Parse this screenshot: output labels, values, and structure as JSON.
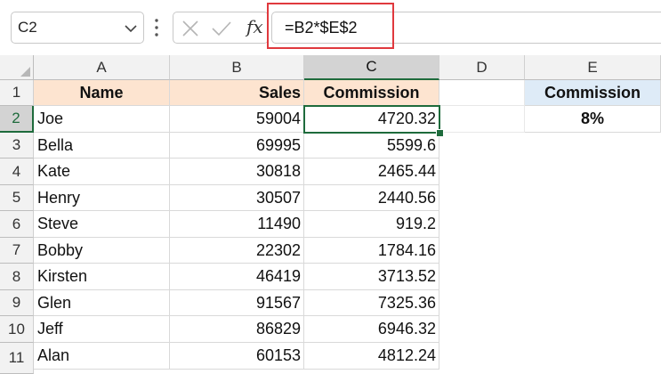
{
  "name_box": {
    "value": "C2"
  },
  "formula_bar": {
    "formula": "=B2*$E$2",
    "fx_label": "fx"
  },
  "columns": [
    "A",
    "B",
    "C",
    "D",
    "E"
  ],
  "rows": [
    "1",
    "2",
    "3",
    "4",
    "5",
    "6",
    "7",
    "8",
    "9",
    "10",
    "11"
  ],
  "table": {
    "headers": [
      "Name",
      "Sales",
      "Commission"
    ],
    "data": [
      [
        "Joe",
        "59004",
        "4720.32"
      ],
      [
        "Bella",
        "69995",
        "5599.6"
      ],
      [
        "Kate",
        "30818",
        "2465.44"
      ],
      [
        "Henry",
        "30507",
        "2440.56"
      ],
      [
        "Steve",
        "11490",
        "919.2"
      ],
      [
        "Bobby",
        "22302",
        "1784.16"
      ],
      [
        "Kirsten",
        "46419",
        "3713.52"
      ],
      [
        "Glen",
        "91567",
        "7325.36"
      ],
      [
        "Jeff",
        "86829",
        "6946.32"
      ],
      [
        "Alan",
        "60153",
        "4812.24"
      ]
    ]
  },
  "side_table": {
    "header": "Commission",
    "value": "8%"
  },
  "selection": {
    "active_cell": "C2",
    "active_column": "C",
    "active_row": "2"
  },
  "colors": {
    "header_fill": "#fde4d0",
    "side_header_fill": "#deebf7",
    "selection_green": "#1e6b3c",
    "highlight_red": "#e0393e"
  },
  "icons": {
    "name_box_dropdown": "chevron-down-icon",
    "more_options": "vertical-ellipsis-icon",
    "cancel": "x-icon",
    "enter": "checkmark-icon",
    "insert_function": "fx-icon"
  }
}
